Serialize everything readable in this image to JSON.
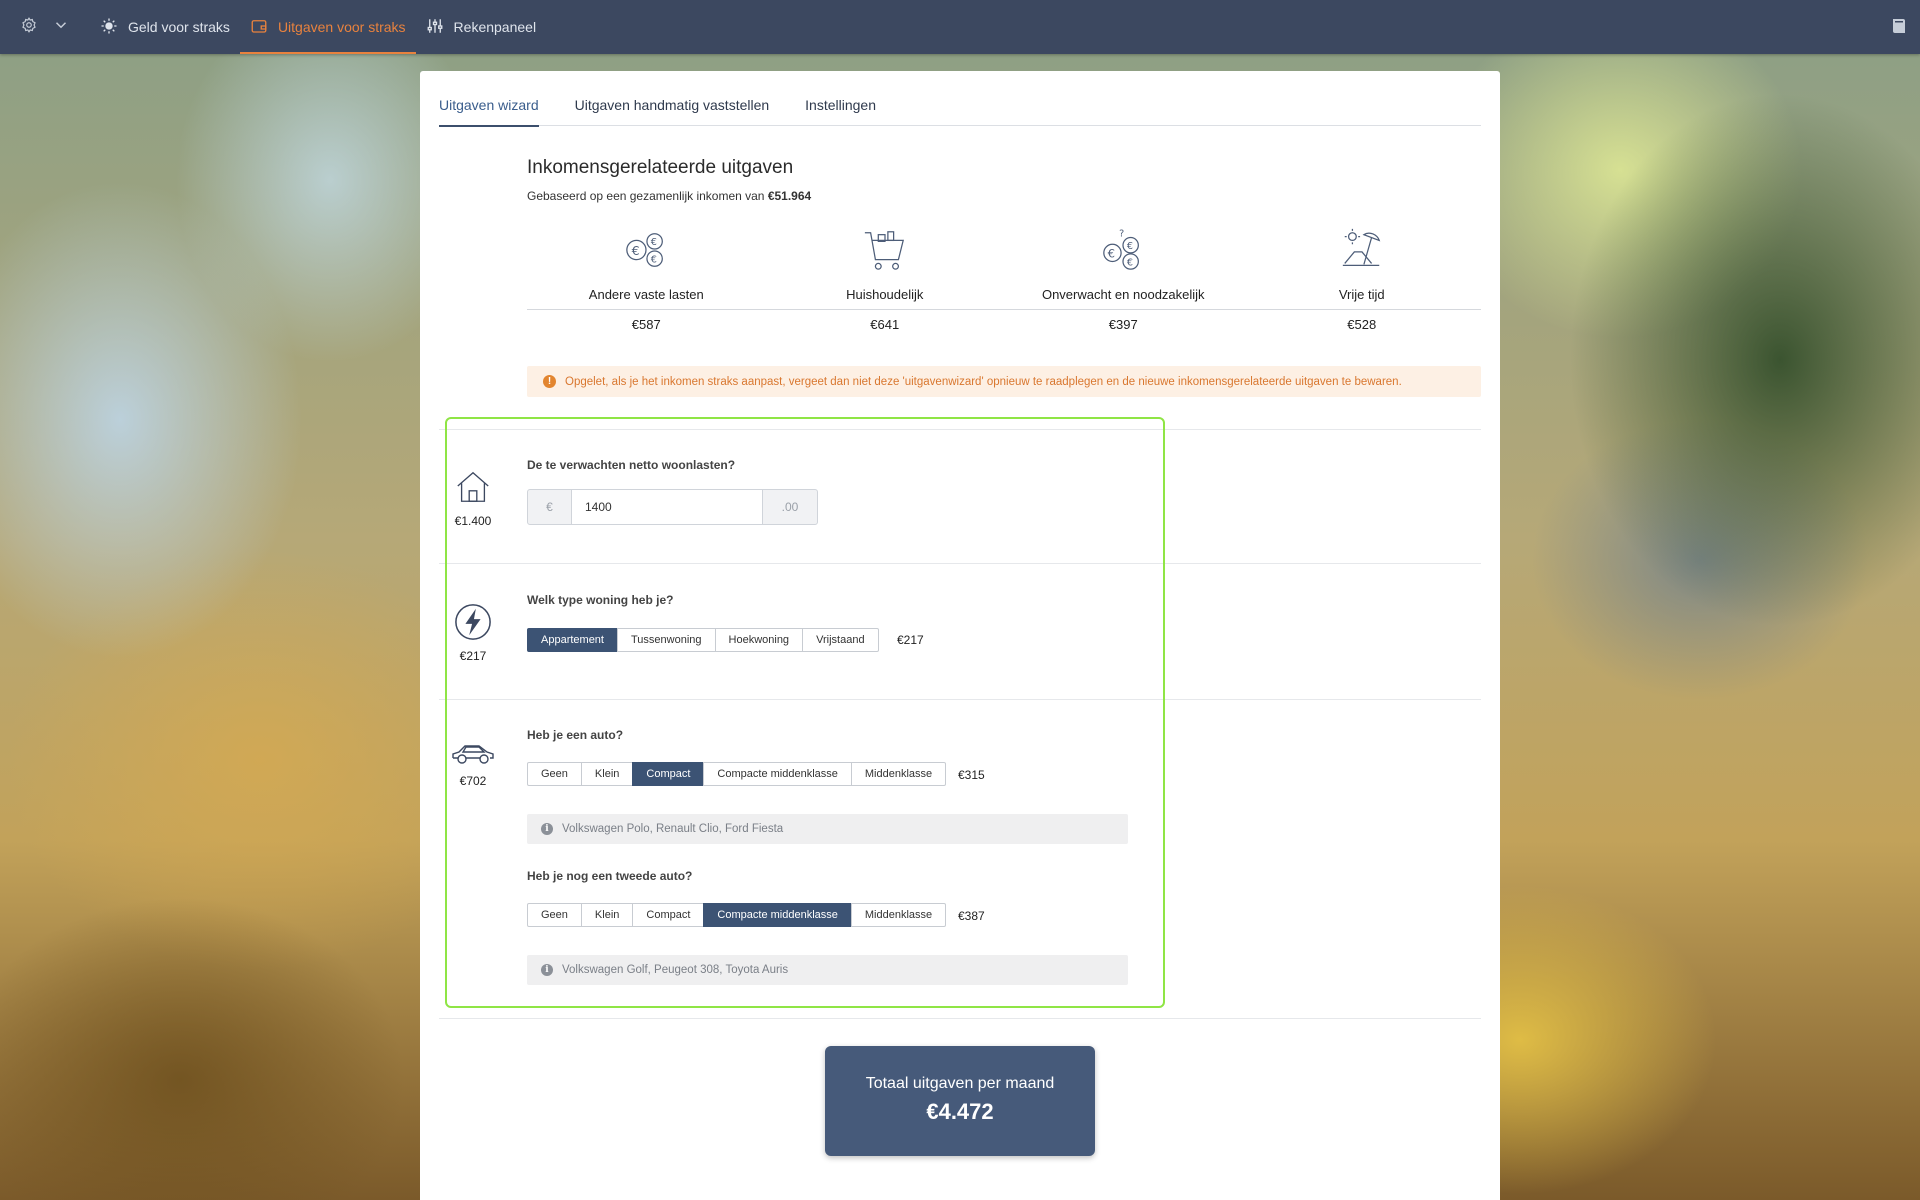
{
  "topnav": {
    "items": [
      {
        "label": "Geld voor straks"
      },
      {
        "label": "Uitgaven voor straks"
      },
      {
        "label": "Rekenpaneel"
      }
    ]
  },
  "tabs": [
    "Uitgaven wizard",
    "Uitgaven handmatig vaststellen",
    "Instellingen"
  ],
  "income_section": {
    "title": "Inkomensgerelateerde uitgaven",
    "subtitle_prefix": "Gebaseerd op een gezamenlijk inkomen van",
    "income": "€51.964",
    "categories": [
      {
        "label": "Andere vaste lasten",
        "amount": "€587",
        "icon": "euro-coins-icon"
      },
      {
        "label": "Huishoudelijk",
        "amount": "€641",
        "icon": "shopping-cart-icon"
      },
      {
        "label": "Onverwacht en noodzakelijk",
        "amount": "€397",
        "icon": "coins-question-icon"
      },
      {
        "label": "Vrije tijd",
        "amount": "€528",
        "icon": "beach-chair-icon"
      }
    ],
    "warning": "Opgelet, als je het inkomen straks aanpast, vergeet dan niet deze 'uitgavenwizard' opnieuw te raadplegen en de nieuwe inkomensgerelateerde uitgaven te bewaren."
  },
  "housing": {
    "question": "De te verwachten netto woonlasten?",
    "amount": "€1.400",
    "prefix": "€",
    "value": "1400",
    "suffix": ".00"
  },
  "dwelling": {
    "question": "Welk type woning heb je?",
    "amount": "€217",
    "options": [
      "Appartement",
      "Tussenwoning",
      "Hoekwoning",
      "Vrijstaand"
    ],
    "selected": "Appartement",
    "cost": "€217"
  },
  "car": {
    "question": "Heb je een auto?",
    "amount": "€702",
    "options": [
      "Geen",
      "Klein",
      "Compact",
      "Compacte middenklasse",
      "Middenklasse"
    ],
    "selected": "Compact",
    "cost": "€315",
    "info": "Volkswagen Polo, Renault Clio, Ford Fiesta"
  },
  "second_car": {
    "question": "Heb je nog een tweede auto?",
    "options": [
      "Geen",
      "Klein",
      "Compact",
      "Compacte middenklasse",
      "Middenklasse"
    ],
    "selected": "Compacte middenklasse",
    "cost": "€387",
    "info": "Volkswagen Golf, Peugeot 308, Toyota Auris"
  },
  "total": {
    "label": "Totaal uitgaven per maand",
    "value": "€4.472"
  },
  "colors": {
    "topbar": "#3c4860",
    "accent_orange": "#e8823e",
    "selected_button": "#3c5374",
    "highlight_border": "#8fe545"
  }
}
